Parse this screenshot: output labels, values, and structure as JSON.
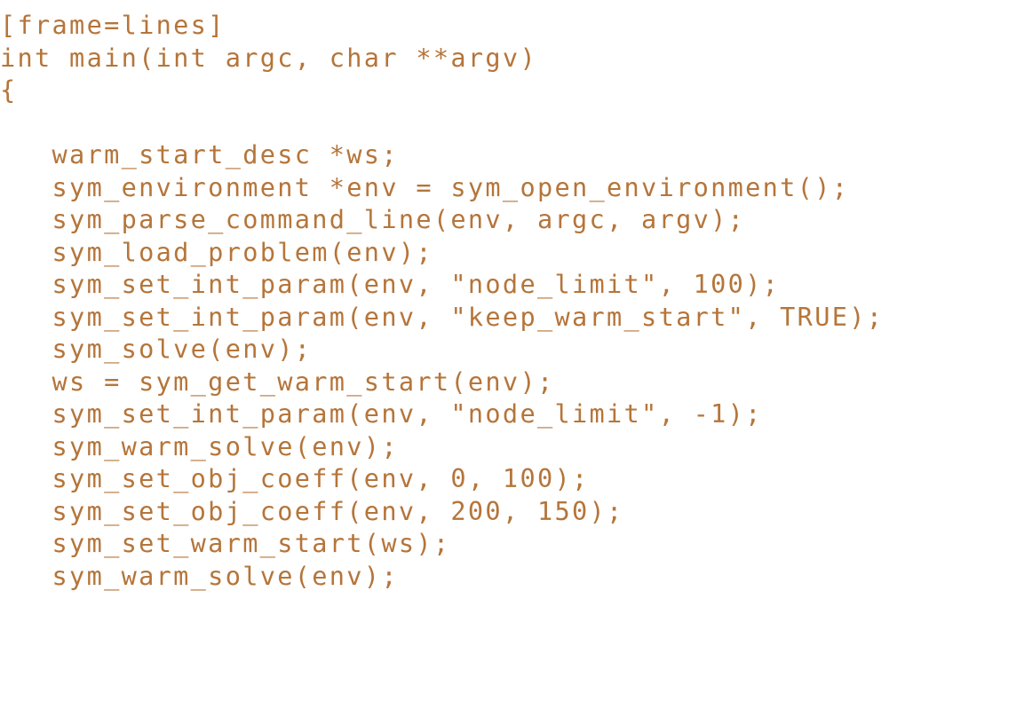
{
  "document": {
    "kind": "code-listing",
    "language": "C",
    "background_color": "#ffffff",
    "text_color": "#b5753a",
    "indent_spaces": 3,
    "line_count": 18
  },
  "code": {
    "lines": [
      "[frame=lines]",
      "int main(int argc, char **argv)",
      "{",
      "",
      "   warm_start_desc *ws;",
      "   sym_environment *env = sym_open_environment();",
      "   sym_parse_command_line(env, argc, argv);",
      "   sym_load_problem(env);",
      "   sym_set_int_param(env, \"node_limit\", 100);",
      "   sym_set_int_param(env, \"keep_warm_start\", TRUE);",
      "   sym_solve(env);",
      "   ws = sym_get_warm_start(env);",
      "   sym_set_int_param(env, \"node_limit\", -1);",
      "   sym_warm_solve(env);",
      "   sym_set_obj_coeff(env, 0, 100);",
      "   sym_set_obj_coeff(env, 200, 150);",
      "   sym_set_warm_start(ws);",
      "   sym_warm_solve(env);"
    ]
  }
}
